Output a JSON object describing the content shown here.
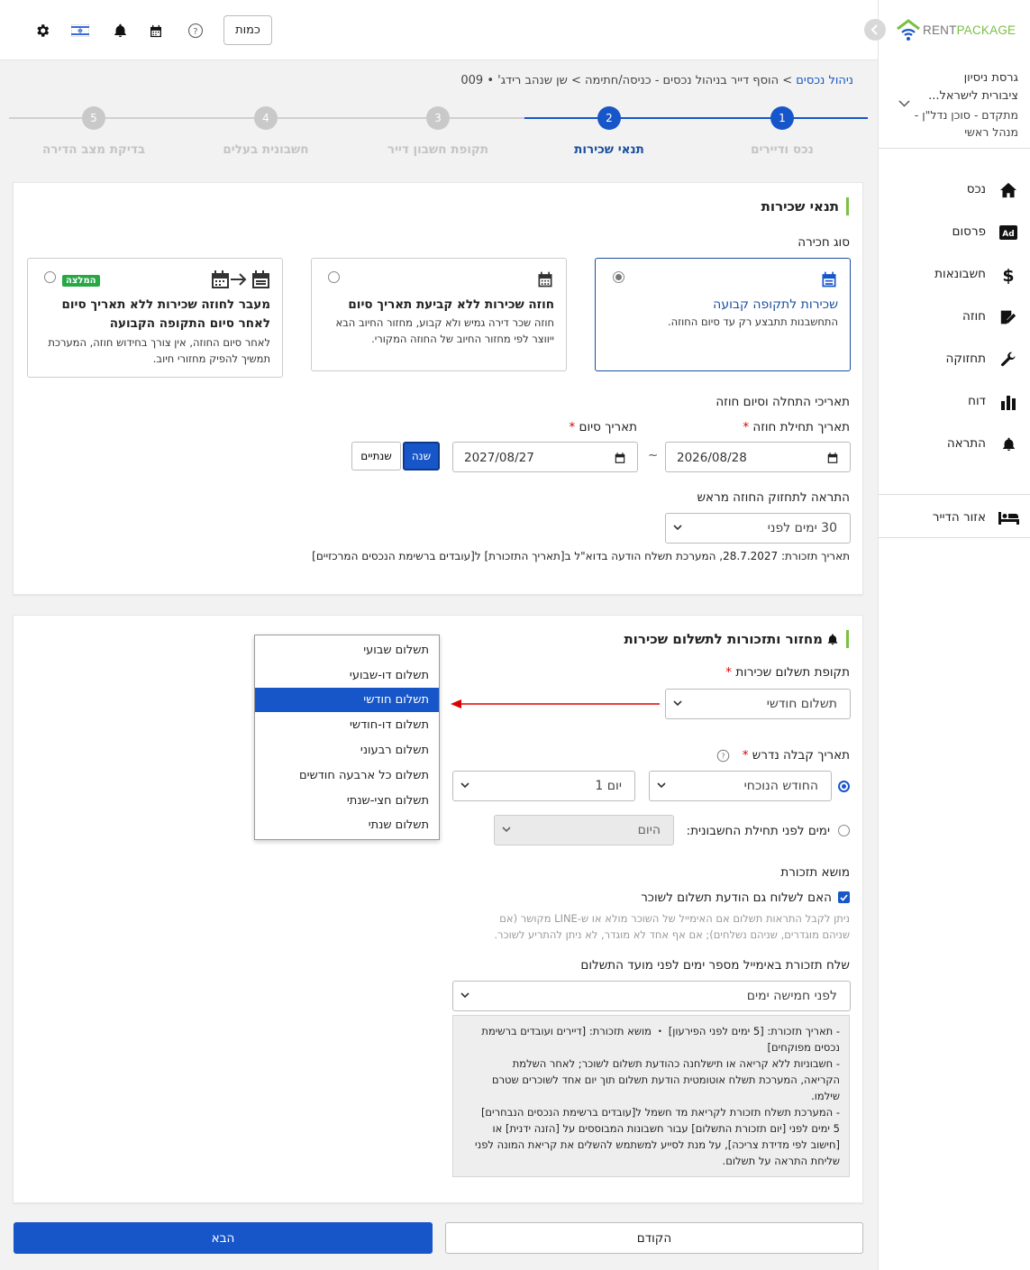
{
  "brand": {
    "name": "RENTPACKAGE",
    "name_part1": "RENT",
    "name_part2": "PACKAGE",
    "color_green": "#7ac043",
    "color_blue": "#1756c9"
  },
  "topbar": {
    "quantity_label": "כמות",
    "icons": [
      "gear-icon",
      "flag-icon",
      "bell-icon",
      "calendar-icon",
      "help-icon"
    ]
  },
  "account": {
    "line1": "גרסת ניסיון",
    "line2": "ציבורית לישראל...",
    "line3": "מתקדם - סוכן נדל\"ן -",
    "line4": "מנהל ראשי"
  },
  "sidebar": {
    "items": [
      {
        "label": "נכס",
        "icon": "home-icon"
      },
      {
        "label": "פרסום",
        "icon": "ad-icon"
      },
      {
        "label": "חשבונאות",
        "icon": "dollar-icon"
      },
      {
        "label": "חוזה",
        "icon": "contract-icon"
      },
      {
        "label": "תחזוקה",
        "icon": "wrench-icon"
      },
      {
        "label": "דוח",
        "icon": "chart-icon"
      },
      {
        "label": "התראה",
        "icon": "bell-icon"
      }
    ],
    "tenant_area": {
      "label": "אזור הדייר",
      "icon": "bed-icon"
    }
  },
  "breadcrumb": {
    "link": "ניהול נכסים",
    "sep1": ">",
    "middle": "הוסף דייר בניהול נכסים - כניסה/חתימה",
    "sep2": ">",
    "tail": "שן שנהב רידג' • 009"
  },
  "steps": [
    {
      "num": "1",
      "label": "נכס ודיירים",
      "state": "done"
    },
    {
      "num": "2",
      "label": "תנאי שכירות",
      "state": "current"
    },
    {
      "num": "3",
      "label": "תקופת חשבון דייר",
      "state": "todo"
    },
    {
      "num": "4",
      "label": "חשבונית בעלים",
      "state": "todo"
    },
    {
      "num": "5",
      "label": "בדיקת מצב הדירה",
      "state": "todo"
    }
  ],
  "rent_terms": {
    "title": "תנאי שכירות",
    "rent_type_label": "סוג חכירה",
    "options": [
      {
        "title": "שכירות לתקופה קבועה",
        "desc1": "התחשבנות תתבצע רק עד סיום החוזה.",
        "desc2": "",
        "desc3": "",
        "selected": true
      },
      {
        "title": "חוזה שכירות ללא קביעת תאריך סיום",
        "desc1": "חוזה שכר דירה גמיש ולא קבוע, מחזור החיוב הבא",
        "desc2": "ייווצר לפי מחזור החיוב של החוזה המקורי.",
        "desc3": "",
        "selected": false
      },
      {
        "title": "מעבר לחוזה שכירות ללא תאריך סיום",
        "title2": "לאחר סיום התקופה הקבועה",
        "desc1": "לאחר סיום החוזה, אין צורך בחידוש חוזה, המערכת",
        "desc2": "תמשיך להפיק מחזורי חיוב.",
        "badge": "המלצה",
        "selected": false
      }
    ],
    "dates_section_label": "תאריכי התחלה וסיום חוזה",
    "start_label": "תאריך תחילת חוזה",
    "end_label": "תאריך סיום",
    "start_value": "2026/08/28",
    "end_value": "2027/08/27",
    "tilde": "~",
    "year_btn": "שנה",
    "two_years_btn": "שנתיים",
    "expiry_label": "התראה לתחזוק החוזה מראש",
    "expiry_value": "30 ימים לפני",
    "reminder_note": "תאריך תזכורת: 28.7.2027, המערכת תשלח הודעה בדוא\"ל ב[תאריך התזכורת] ל[עובדים ברשימת הנכסים המרכזיים]"
  },
  "payment": {
    "title": "מחזור ותזכורות לתשלום שכירות",
    "period_label": "תקופת תשלום שכירות",
    "period_value": "תשלום חודשי",
    "dropdown": [
      "תשלום שבועי",
      "תשלום דו-שבועי",
      "תשלום חודשי",
      "תשלום דו-חודשי",
      "תשלום רבעוני",
      "תשלום כל ארבעה חודשים",
      "תשלום חצי-שנתי",
      "תשלום שנתי"
    ],
    "dropdown_selected_index": 2,
    "due_label": "תאריך קבלה נדרש",
    "month_value": "החודש הנוכחי",
    "day_value": "יום 1",
    "days_before_label": "ימים לפני תחילת החשבונית:",
    "days_before_value": "היום",
    "subject_label": "מושא תזכורת",
    "notify_tenant_label": "האם לשלוח גם הודעת תשלום לשוכר",
    "notify_hint1": "ניתן לקבל התראות תשלום אם האימייל של השוכר מולא או ש-LINE מקושר (אם",
    "notify_hint2": "שניהם מוגדרים, שניהם נשלחים); אם אף אחד לא מוגדר, לא ניתן להתריע לשוכר.",
    "email_reminder_label": "שלח תזכורת באימייל מספר ימים לפני מועד התשלום",
    "email_reminder_value": "לפני חמישה ימים",
    "notes": [
      "- תאריך תזכורת: [5 ימים לפני הפירעון] ・ מושא תזכורת: [דיירים ועובדים ברשימת",
      "נכסים מפוקחים]",
      "- חשבוניות ללא קריאה או תישלחנה כהודעת תשלום לשוכר; לאחר השלמת",
      "הקריאה, המערכת תשלח אוטומטית הודעת תשלום תוך יום אחד לשוכרים שטרם",
      "שילמו.",
      "- המערכת תשלח תזכורת לקריאת מד חשמל ל[עובדים ברשימת הנכסים הנבחרים]",
      "5 ימים לפני [יום תזכורת התשלום] עבור חשבונות המבוססים על [הזנה ידנית] או",
      "[חישוב לפי מדידת צריכה], על מנת לסייע למשתמש להשלים את קריאת המונה לפני",
      "שליחת התראה על תשלום."
    ]
  },
  "footer": {
    "prev_label": "הקודם",
    "next_label": "הבא"
  }
}
